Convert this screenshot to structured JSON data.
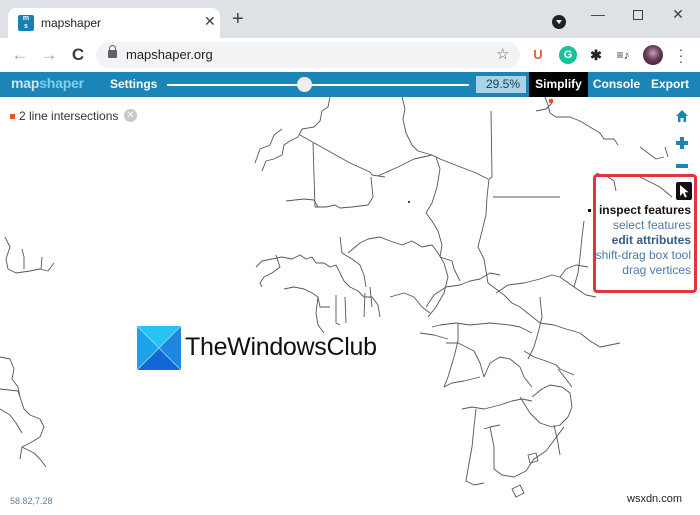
{
  "browser": {
    "tab_title": "mapshaper",
    "tab_close": "✕",
    "new_tab": "+",
    "url": "mapshaper.org",
    "nav": {
      "back": "←",
      "forward": "→",
      "reload": "C"
    },
    "window": {
      "minimize": "—",
      "close": "✕"
    },
    "extensions": {
      "u": "U",
      "g": "G",
      "puzzle": "✱",
      "media": "≡♪"
    },
    "star": "☆",
    "menu": "⋮"
  },
  "header": {
    "logo_prefix": "map",
    "logo_suffix": "shaper",
    "settings_label": "Settings",
    "simplify_pct": "29.5%",
    "simplify_fraction": 0.295,
    "simplify_label": "Simplify",
    "console_label": "Console",
    "export_label": "Export"
  },
  "map": {
    "intersections_label": "2 line intersections",
    "intersections_close": "✕",
    "controls": {
      "home": "⌂",
      "zoom_in": "+",
      "zoom_out": "−"
    },
    "tools": {
      "items": [
        {
          "label": "inspect features",
          "state": "active"
        },
        {
          "label": "select features",
          "state": "normal"
        },
        {
          "label": "edit attributes",
          "state": "bold"
        },
        {
          "label": "shift-drag box tool",
          "state": "normal"
        },
        {
          "label": "drag vertices",
          "state": "normal"
        }
      ]
    },
    "coordinates": "58.82,7.28"
  },
  "watermark": {
    "text": "TheWindowsClub",
    "site": "wsxdn.com"
  },
  "colors": {
    "header_bg": "#1b85b8",
    "tools_border": "#e0353a",
    "intersection": "#e8512c",
    "line": "#555555"
  }
}
